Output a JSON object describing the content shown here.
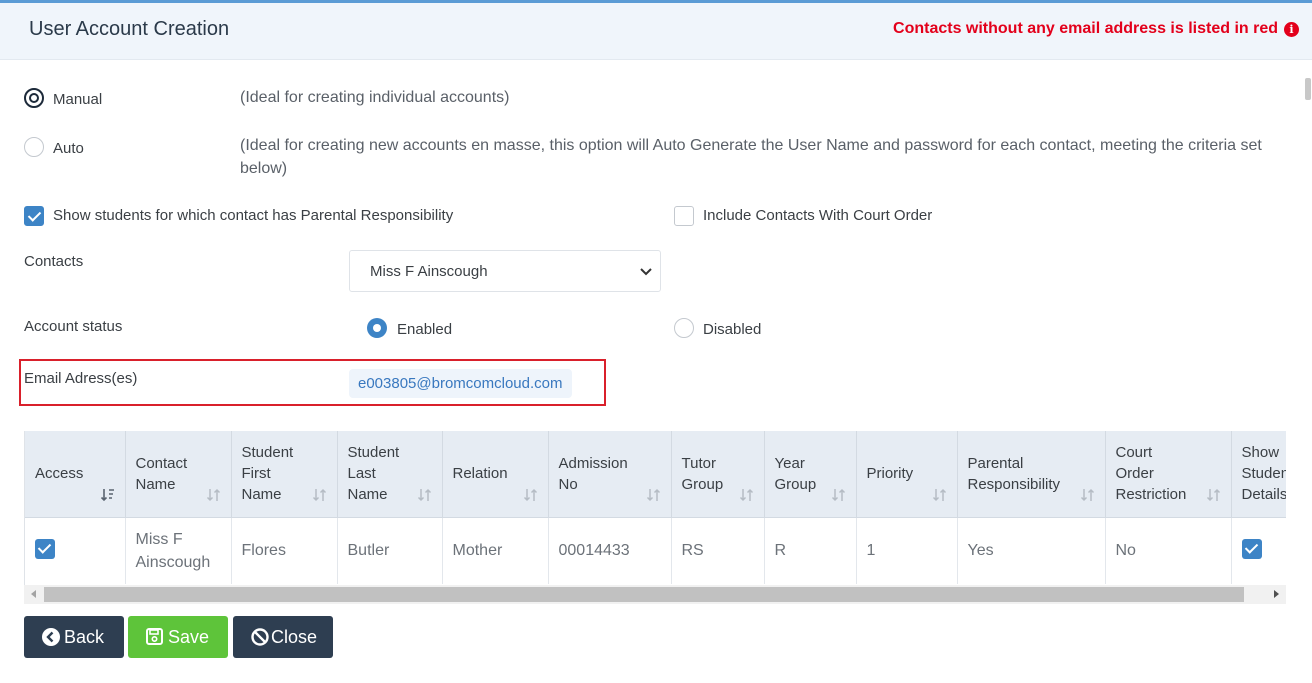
{
  "header": {
    "title": "User Account Creation",
    "warning": "Contacts without any email address is listed in red"
  },
  "mode": {
    "manual_label": "Manual",
    "manual_desc": "(Ideal for creating individual accounts)",
    "auto_label": "Auto",
    "auto_desc": "(Ideal for creating new accounts en masse, this option will Auto Generate the User Name and password for each contact, meeting the criteria set below)",
    "selected": "Manual"
  },
  "options": {
    "show_students_label": "Show students for which contact has Parental Responsibility",
    "show_students_checked": true,
    "court_order_label": "Include Contacts With Court Order",
    "court_order_checked": false
  },
  "contacts": {
    "label": "Contacts",
    "selected": "Miss F Ainscough"
  },
  "account_status": {
    "label": "Account status",
    "enabled_label": "Enabled",
    "disabled_label": "Disabled",
    "selected": "Enabled"
  },
  "email": {
    "label": "Email Adress(es)",
    "value": "e003805@bromcomcloud.com"
  },
  "table": {
    "columns": [
      {
        "label": "Access",
        "lines": [
          "Access"
        ]
      },
      {
        "label": "Contact Name",
        "lines": [
          "Contact",
          "Name"
        ]
      },
      {
        "label": "Student First Name",
        "lines": [
          "Student",
          "First",
          "Name"
        ]
      },
      {
        "label": "Student Last Name",
        "lines": [
          "Student",
          "Last",
          "Name"
        ]
      },
      {
        "label": "Relation",
        "lines": [
          "Relation"
        ]
      },
      {
        "label": "Admission No",
        "lines": [
          "Admission",
          "No"
        ]
      },
      {
        "label": "Tutor Group",
        "lines": [
          "Tutor",
          "Group"
        ]
      },
      {
        "label": "Year Group",
        "lines": [
          "Year",
          "Group"
        ]
      },
      {
        "label": "Priority",
        "lines": [
          "Priority"
        ]
      },
      {
        "label": "Parental Responsibility",
        "lines": [
          "Parental",
          "Responsibility"
        ]
      },
      {
        "label": "Court Order Restriction",
        "lines": [
          "Court",
          "Order",
          "Restriction"
        ]
      },
      {
        "label": "Show Student Details",
        "lines": [
          "Show",
          "Student",
          "Details"
        ]
      }
    ],
    "rows": [
      {
        "access": true,
        "contact_name": "Miss F Ainscough",
        "contact_name_lines": [
          "Miss F",
          "Ainscough"
        ],
        "student_first_name": "Flores",
        "student_last_name": "Butler",
        "relation": "Mother",
        "admission_no": "00014433",
        "tutor_group": "RS",
        "year_group": "R",
        "priority": "1",
        "parental_responsibility": "Yes",
        "court_order_restriction": "No",
        "show_student_details": true
      }
    ]
  },
  "buttons": {
    "back": "Back",
    "save": "Save",
    "close": "Close"
  },
  "colors": {
    "accent": "#3d84c6",
    "warning": "#e3001b",
    "save": "#5ec43a",
    "dark": "#2e3e51"
  }
}
